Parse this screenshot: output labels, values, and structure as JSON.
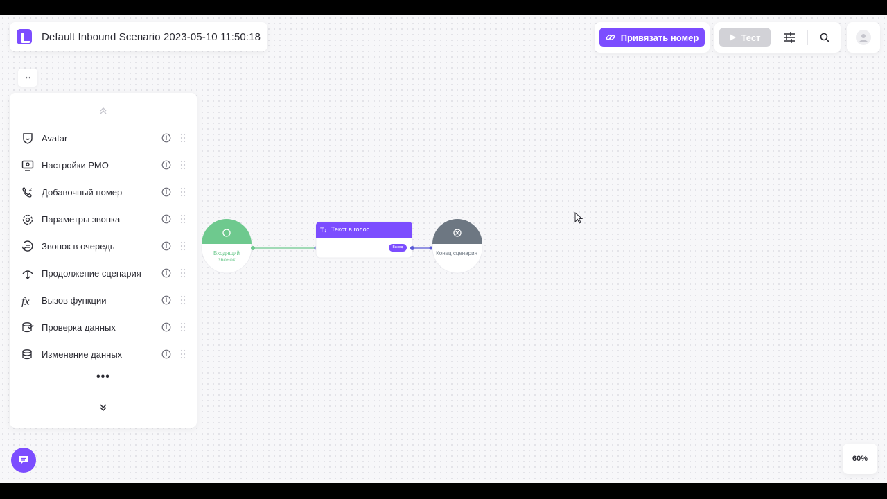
{
  "header": {
    "scenario_title": "Default Inbound Scenario 2023-05-10 11:50:18",
    "bind_number_label": "Привязать номер",
    "test_label": "Тест"
  },
  "panel": {
    "items": [
      {
        "label": "Avatar",
        "icon": "avatar-shield-icon"
      },
      {
        "label": "Настройки РМО",
        "icon": "operator-settings-icon"
      },
      {
        "label": "Добавочный номер",
        "icon": "phone-hash-icon"
      },
      {
        "label": "Параметры звонка",
        "icon": "call-gear-icon"
      },
      {
        "label": "Звонок в очередь",
        "icon": "call-queue-icon"
      },
      {
        "label": "Продолжение сценария",
        "icon": "continue-scenario-icon"
      },
      {
        "label": "Вызов функции",
        "icon": "function-fx-icon"
      },
      {
        "label": "Проверка данных",
        "icon": "data-check-icon"
      },
      {
        "label": "Изменение данных",
        "icon": "data-edit-icon"
      }
    ],
    "more": "•••",
    "collapse_toggle": "›‹"
  },
  "flow": {
    "incoming_node": "Входящий звонок",
    "tts_node_title": "Текст в голос",
    "tts_exit_label": "Выход",
    "end_node": "Конец сценария"
  },
  "zoom": "60%",
  "colors": {
    "accent": "#7c4dff",
    "incoming": "#6ec98e",
    "end": "#6d7782"
  }
}
